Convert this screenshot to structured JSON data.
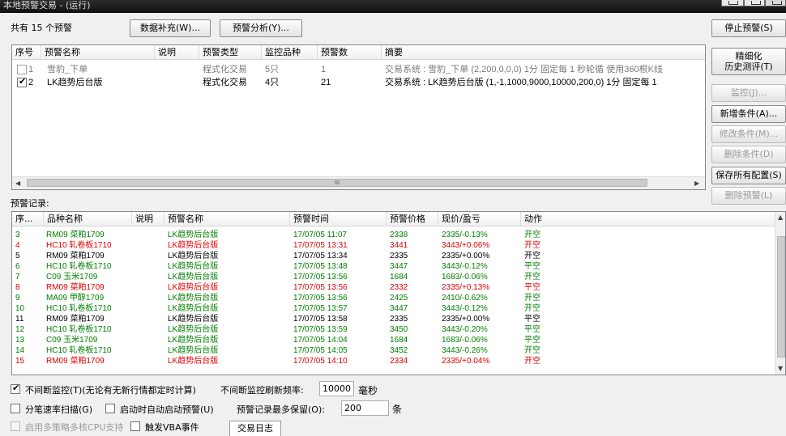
{
  "window": {
    "title": "本地预警交易 - (运行)"
  },
  "header": {
    "total_text": "共有 15 个预警",
    "supplement_button": "数据补充(W)...",
    "analysis_button": "预警分析(Y)..."
  },
  "side_buttons": {
    "stop": "停止预警(S)",
    "refine_line1": "精细化",
    "refine_line2": "历史测评(T)",
    "monitor": "监控(J)...",
    "add_condition": "新增条件(A)...",
    "edit_condition": "修改条件(M)...",
    "delete_condition": "删除条件(D)",
    "save_all": "保存所有配置(S)",
    "delete_alert": "删除预警(L)"
  },
  "alert_table": {
    "columns": [
      "序号",
      "预警名称",
      "说明",
      "预警类型",
      "监控品种",
      "预警数",
      "摘要"
    ],
    "rows": [
      {
        "checked": false,
        "index": "1",
        "name": "雪豹_下单",
        "desc": "",
        "type": "程式化交易",
        "symbols": "5只",
        "count": "1",
        "summary": "交易系统 : 雪豹_下单 (2,200,0,0,0) 1分 固定每 1 秒轮循 使用360根K线",
        "active": false
      },
      {
        "checked": true,
        "index": "2",
        "name": "LK趋势后台版",
        "desc": "",
        "type": "程式化交易",
        "symbols": "4只",
        "count": "21",
        "summary": "交易系统 : LK趋势后台版 (1,-1,1000,9000,10000,200,0) 1分 固定每 1",
        "active": true
      }
    ],
    "scroll_mark": "III"
  },
  "records": {
    "label": "预警记录:",
    "columns": [
      "序...",
      "品种名称",
      "说明",
      "预警名称",
      "预警时间",
      "预警价格",
      "现价/盈亏",
      "动作"
    ],
    "rows": [
      {
        "n": "3",
        "sym": "RM09 菜粕1709",
        "desc": "",
        "alert": "LK趋势后台版",
        "time": "17/07/05 11:07",
        "price": "2338",
        "now": "2335/-0.13%",
        "action": "开空",
        "color": "green"
      },
      {
        "n": "4",
        "sym": "HC10 轧卷板1710",
        "desc": "",
        "alert": "LK趋势后台版",
        "time": "17/07/05 13:31",
        "price": "3441",
        "now": "3443/+0.06%",
        "action": "开空",
        "color": "red"
      },
      {
        "n": "5",
        "sym": "RM09 菜粕1709",
        "desc": "",
        "alert": "LK趋势后台版",
        "time": "17/07/05 13:34",
        "price": "2335",
        "now": "2335/+0.00%",
        "action": "开空",
        "color": "black"
      },
      {
        "n": "6",
        "sym": "HC10 轧卷板1710",
        "desc": "",
        "alert": "LK趋势后台版",
        "time": "17/07/05 13:48",
        "price": "3447",
        "now": "3443/-0.12%",
        "action": "平空",
        "color": "green"
      },
      {
        "n": "7",
        "sym": "C09 玉米1709",
        "desc": "",
        "alert": "LK趋势后台版",
        "time": "17/07/05 13:56",
        "price": "1684",
        "now": "1683/-0.06%",
        "action": "开空",
        "color": "green"
      },
      {
        "n": "8",
        "sym": "RM09 菜粕1709",
        "desc": "",
        "alert": "LK趋势后台版",
        "time": "17/07/05 13:56",
        "price": "2332",
        "now": "2335/+0.13%",
        "action": "平空",
        "color": "red"
      },
      {
        "n": "9",
        "sym": "MA09 甲醇1709",
        "desc": "",
        "alert": "LK趋势后台版",
        "time": "17/07/05 13:56",
        "price": "2425",
        "now": "2410/-0.62%",
        "action": "开空",
        "color": "green"
      },
      {
        "n": "10",
        "sym": "HC10 轧卷板1710",
        "desc": "",
        "alert": "LK趋势后台版",
        "time": "17/07/05 13:57",
        "price": "3447",
        "now": "3443/-0.12%",
        "action": "开空",
        "color": "green"
      },
      {
        "n": "11",
        "sym": "RM09 菜粕1709",
        "desc": "",
        "alert": "LK趋势后台版",
        "time": "17/07/05 13:58",
        "price": "2335",
        "now": "2335/+0.00%",
        "action": "平空",
        "color": "black"
      },
      {
        "n": "12",
        "sym": "HC10 轧卷板1710",
        "desc": "",
        "alert": "LK趋势后台版",
        "time": "17/07/05 13:59",
        "price": "3450",
        "now": "3443/-0.20%",
        "action": "平空",
        "color": "green"
      },
      {
        "n": "13",
        "sym": "C09 玉米1709",
        "desc": "",
        "alert": "LK趋势后台版",
        "time": "17/07/05 14:04",
        "price": "1684",
        "now": "1683/-0.06%",
        "action": "平空",
        "color": "green"
      },
      {
        "n": "14",
        "sym": "HC10 轧卷板1710",
        "desc": "",
        "alert": "LK趋势后台版",
        "time": "17/07/05 14:05",
        "price": "3452",
        "now": "3443/-0.26%",
        "action": "开空",
        "color": "green"
      },
      {
        "n": "15",
        "sym": "RM09 菜粕1709",
        "desc": "",
        "alert": "LK趋势后台版",
        "time": "17/07/05 14:10",
        "price": "2334",
        "now": "2335/+0.04%",
        "action": "开空",
        "color": "red"
      }
    ]
  },
  "options": {
    "continuous_label": "不间断监控(T)(无论有无新行情都定时计算)",
    "continuous_checked": true,
    "refresh_label": "不间断监控刷新频率:",
    "refresh_value": "10000",
    "refresh_unit": "毫秒",
    "tick_scan_label": "分笔速率扫描(G)",
    "tick_scan_checked": false,
    "autostart_label": "启动时自动启动预警(U)",
    "autostart_checked": false,
    "keep_label": "预警记录最多保留(O):",
    "keep_value": "200",
    "keep_unit": "条",
    "multicore_label": "启用多策略多核CPU支持",
    "multicore_checked": false,
    "vba_label": "触发VBA事件",
    "vba_checked": false,
    "log_tab": "交易日志"
  }
}
